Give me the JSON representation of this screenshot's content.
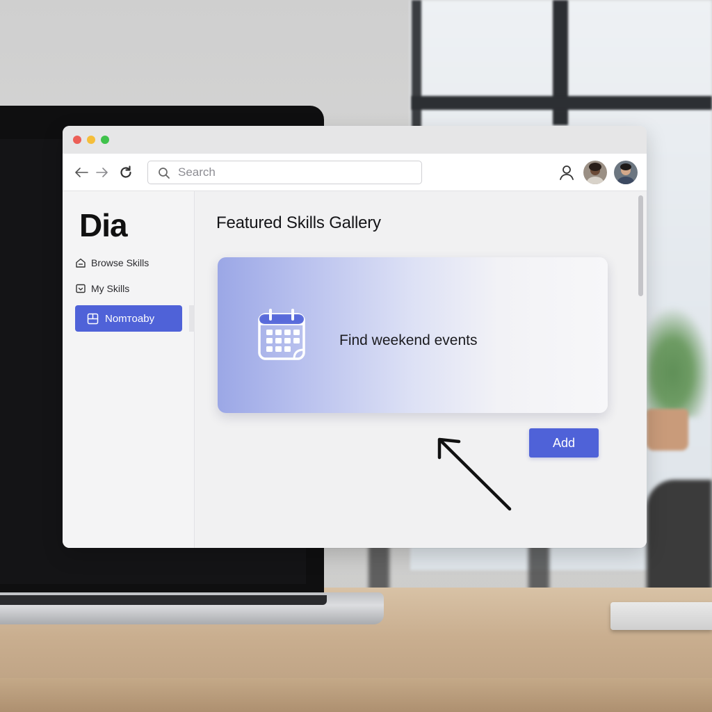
{
  "window": {
    "traffic_lights": [
      "#ec5f57",
      "#f5be3a",
      "#3fc24b"
    ]
  },
  "toolbar": {
    "back_icon": "arrow-left-icon",
    "forward_icon": "arrow-right-icon",
    "reload_icon": "reload-icon",
    "search_placeholder": "Search",
    "search_value": ""
  },
  "sidebar": {
    "brand": "Dia",
    "items": [
      {
        "label": "Browse Skills",
        "icon": "home-icon"
      },
      {
        "label": "My Skills",
        "icon": "inbox-icon"
      },
      {
        "label": "Nomтoaby",
        "icon": "layout-icon",
        "active": true
      }
    ]
  },
  "main": {
    "title": "Featured Skills Gallery",
    "card": {
      "label": "Find weekend events",
      "icon": "calendar-icon"
    },
    "add_label": "Add"
  },
  "colors": {
    "accent": "#4f62d8",
    "card_gradient_start": "#9ba7e6"
  }
}
